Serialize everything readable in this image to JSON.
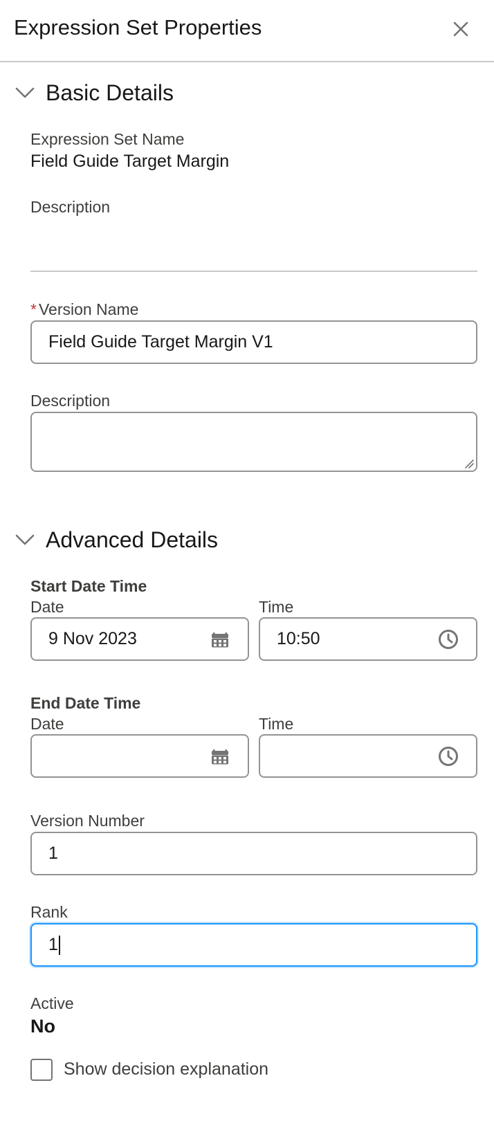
{
  "panel": {
    "title": "Expression Set Properties",
    "close_icon": "close-icon"
  },
  "basic_details": {
    "title": "Basic Details",
    "expression_set_name_label": "Expression Set Name",
    "expression_set_name_value": "Field Guide Target Margin",
    "description_label": "Description",
    "description_value": "",
    "version_name_required_marker": "*",
    "version_name_label": "Version Name",
    "version_name_value": "Field Guide Target Margin V1",
    "version_description_label": "Description",
    "version_description_value": ""
  },
  "advanced_details": {
    "title": "Advanced Details",
    "start": {
      "group_label": "Start Date Time",
      "date_label": "Date",
      "date_value": "9 Nov 2023",
      "date_icon": "calendar-icon",
      "time_label": "Time",
      "time_value": "10:50",
      "time_icon": "clock-icon"
    },
    "end": {
      "group_label": "End Date Time",
      "date_label": "Date",
      "date_value": "",
      "date_icon": "calendar-icon",
      "time_label": "Time",
      "time_value": "",
      "time_icon": "clock-icon"
    },
    "version_number_label": "Version Number",
    "version_number_value": "1",
    "rank_label": "Rank",
    "rank_value": "1",
    "active_label": "Active",
    "active_value": "No",
    "show_explanation_label": "Show decision explanation",
    "show_explanation_checked": false
  },
  "colors": {
    "focus_border": "#1b96ff",
    "required": "#c23934",
    "border": "#939393"
  }
}
